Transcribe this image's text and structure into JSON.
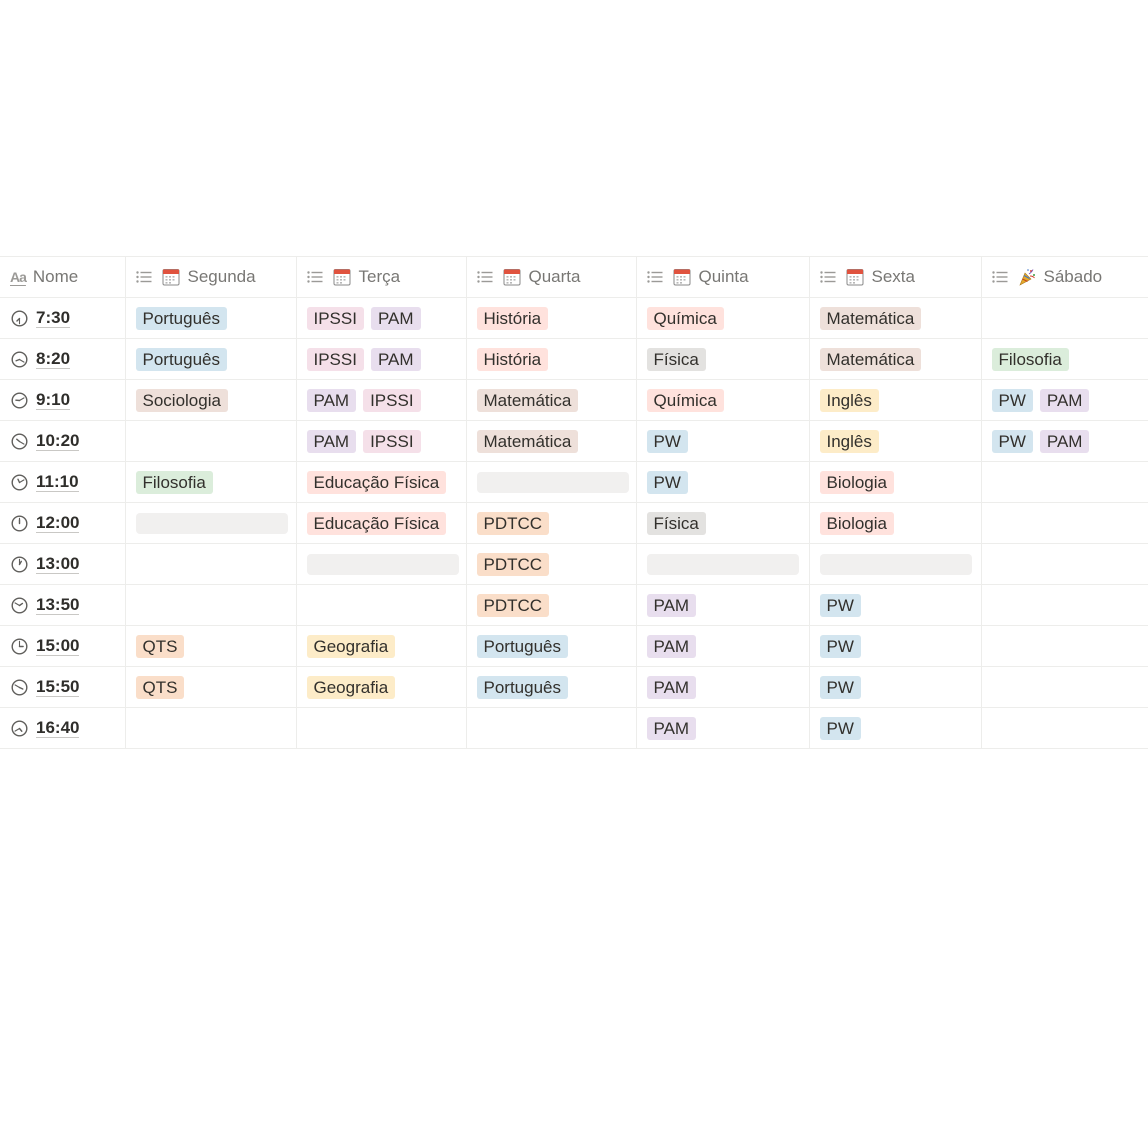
{
  "columns": [
    {
      "label": "Nome",
      "icon": "title-aa-icon"
    },
    {
      "label": "Segunda",
      "icon": "calendar-icon"
    },
    {
      "label": "Terça",
      "icon": "calendar-icon"
    },
    {
      "label": "Quarta",
      "icon": "calendar-icon"
    },
    {
      "label": "Quinta",
      "icon": "calendar-icon"
    },
    {
      "label": "Sexta",
      "icon": "calendar-icon"
    },
    {
      "label": "Sábado",
      "icon": "party-popper-icon"
    }
  ],
  "header_icon_text": "Aa",
  "colors": {
    "blue": "#d3e5ef",
    "pink": "#f5e0e9",
    "purple": "#e8deee",
    "red": "#ffe2dd",
    "brown": "#eee0da",
    "gray": "#e3e2e0",
    "orange": "#fadec9",
    "yellow": "#fdecc8",
    "green": "#dbeddb"
  },
  "rows": [
    {
      "time": "7:30",
      "cells": [
        [
          {
            "text": "Português",
            "color": "blue"
          }
        ],
        [
          {
            "text": "IPSSI",
            "color": "pink"
          },
          {
            "text": "PAM",
            "color": "purple"
          }
        ],
        [
          {
            "text": "História",
            "color": "red"
          }
        ],
        [
          {
            "text": "Química",
            "color": "red"
          }
        ],
        [
          {
            "text": "Matemática",
            "color": "brown"
          }
        ],
        []
      ]
    },
    {
      "time": "8:20",
      "cells": [
        [
          {
            "text": "Português",
            "color": "blue"
          }
        ],
        [
          {
            "text": "IPSSI",
            "color": "pink"
          },
          {
            "text": "PAM",
            "color": "purple"
          }
        ],
        [
          {
            "text": "História",
            "color": "red"
          }
        ],
        [
          {
            "text": "Física",
            "color": "gray"
          }
        ],
        [
          {
            "text": "Matemática",
            "color": "brown"
          }
        ],
        [
          {
            "text": "Filosofia",
            "color": "green"
          }
        ]
      ]
    },
    {
      "time": "9:10",
      "cells": [
        [
          {
            "text": "Sociologia",
            "color": "brown"
          }
        ],
        [
          {
            "text": "PAM",
            "color": "purple"
          },
          {
            "text": "IPSSI",
            "color": "pink"
          }
        ],
        [
          {
            "text": "Matemática",
            "color": "brown"
          }
        ],
        [
          {
            "text": "Química",
            "color": "red"
          }
        ],
        [
          {
            "text": "Inglês",
            "color": "yellow"
          }
        ],
        [
          {
            "text": "PW",
            "color": "blue"
          },
          {
            "text": "PAM",
            "color": "purple"
          }
        ]
      ]
    },
    {
      "time": "10:20",
      "cells": [
        [],
        [
          {
            "text": "PAM",
            "color": "purple"
          },
          {
            "text": "IPSSI",
            "color": "pink"
          }
        ],
        [
          {
            "text": "Matemática",
            "color": "brown"
          }
        ],
        [
          {
            "text": "PW",
            "color": "blue"
          }
        ],
        [
          {
            "text": "Inglês",
            "color": "yellow"
          }
        ],
        [
          {
            "text": "PW",
            "color": "blue"
          },
          {
            "text": "PAM",
            "color": "purple"
          }
        ]
      ]
    },
    {
      "time": "11:10",
      "cells": [
        [
          {
            "text": "Filosofia",
            "color": "green"
          }
        ],
        [
          {
            "text": "Educação Física",
            "color": "red"
          }
        ],
        "empty",
        [
          {
            "text": "PW",
            "color": "blue"
          }
        ],
        [
          {
            "text": "Biologia",
            "color": "red"
          }
        ],
        []
      ]
    },
    {
      "time": "12:00",
      "cells": [
        "empty",
        [
          {
            "text": "Educação Física",
            "color": "red"
          }
        ],
        [
          {
            "text": "PDTCC",
            "color": "orange"
          }
        ],
        [
          {
            "text": "Física",
            "color": "gray"
          }
        ],
        [
          {
            "text": "Biologia",
            "color": "red"
          }
        ],
        []
      ]
    },
    {
      "time": "13:00",
      "cells": [
        [],
        "empty",
        [
          {
            "text": "PDTCC",
            "color": "orange"
          }
        ],
        "empty",
        "empty",
        []
      ]
    },
    {
      "time": "13:50",
      "cells": [
        [],
        [],
        [
          {
            "text": "PDTCC",
            "color": "orange"
          }
        ],
        [
          {
            "text": "PAM",
            "color": "purple"
          }
        ],
        [
          {
            "text": "PW",
            "color": "blue"
          }
        ],
        []
      ]
    },
    {
      "time": "15:00",
      "cells": [
        [
          {
            "text": "QTS",
            "color": "orange"
          }
        ],
        [
          {
            "text": "Geografia",
            "color": "yellow"
          }
        ],
        [
          {
            "text": "Português",
            "color": "blue"
          }
        ],
        [
          {
            "text": "PAM",
            "color": "purple"
          }
        ],
        [
          {
            "text": "PW",
            "color": "blue"
          }
        ],
        []
      ]
    },
    {
      "time": "15:50",
      "cells": [
        [
          {
            "text": "QTS",
            "color": "orange"
          }
        ],
        [
          {
            "text": "Geografia",
            "color": "yellow"
          }
        ],
        [
          {
            "text": "Português",
            "color": "blue"
          }
        ],
        [
          {
            "text": "PAM",
            "color": "purple"
          }
        ],
        [
          {
            "text": "PW",
            "color": "blue"
          }
        ],
        []
      ]
    },
    {
      "time": "16:40",
      "cells": [
        [],
        [],
        [],
        [
          {
            "text": "PAM",
            "color": "purple"
          }
        ],
        [
          {
            "text": "PW",
            "color": "blue"
          }
        ],
        []
      ]
    }
  ]
}
